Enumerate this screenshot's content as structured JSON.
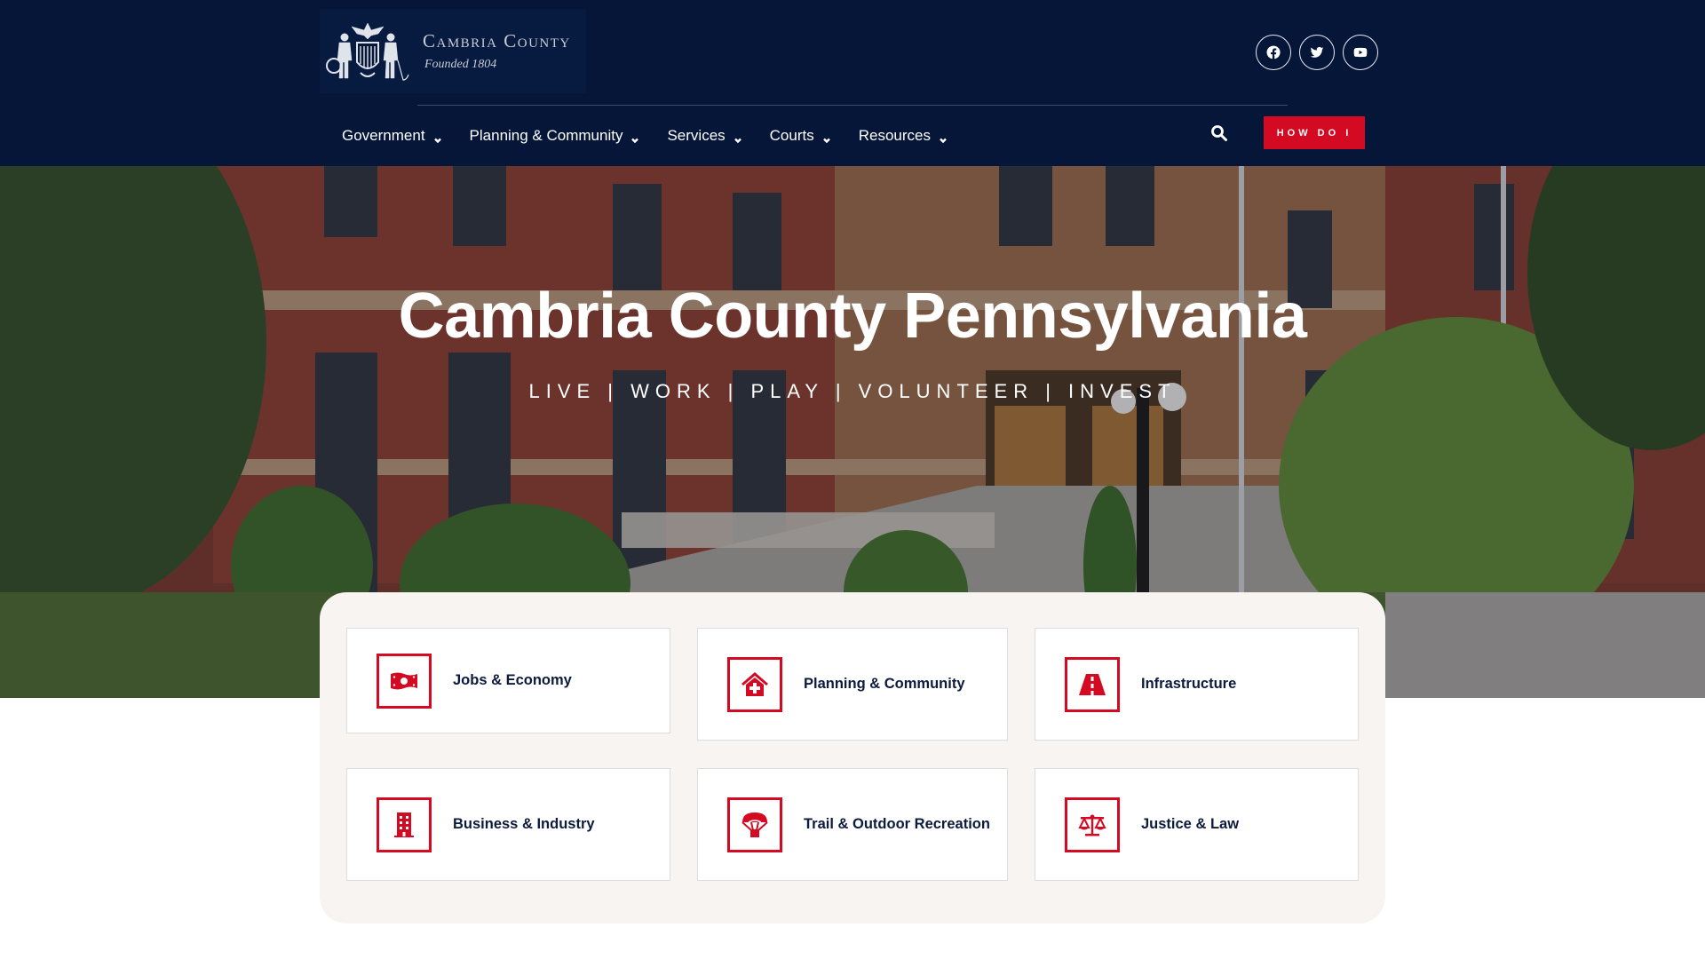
{
  "header": {
    "logo": {
      "name": "Cambria County",
      "tagline": "Founded 1804"
    },
    "social": [
      {
        "name": "facebook",
        "icon": "facebook-icon"
      },
      {
        "name": "twitter",
        "icon": "twitter-icon"
      },
      {
        "name": "youtube",
        "icon": "youtube-icon"
      }
    ],
    "nav": [
      {
        "label": "Government",
        "has_dropdown": true
      },
      {
        "label": "Planning & Community",
        "has_dropdown": true
      },
      {
        "label": "Services",
        "has_dropdown": true
      },
      {
        "label": "Courts",
        "has_dropdown": true
      },
      {
        "label": "Resources",
        "has_dropdown": true
      }
    ],
    "search_icon": "search-icon",
    "cta_label": "HOW DO I"
  },
  "hero": {
    "title": "Cambria County Pennsylvania",
    "subtitle": "LIVE | WORK | PLAY | VOLUNTEER | INVEST"
  },
  "categories": [
    {
      "label": "Jobs & Economy",
      "icon": "money-bill-icon"
    },
    {
      "label": "Planning & Community",
      "icon": "house-medical-icon"
    },
    {
      "label": "Infrastructure",
      "icon": "road-icon"
    },
    {
      "label": "Business & Industry",
      "icon": "building-icon"
    },
    {
      "label": "Trail & Outdoor Recreation",
      "icon": "parachute-box-icon"
    },
    {
      "label": "Justice & Law",
      "icon": "balance-scale-icon"
    }
  ],
  "colors": {
    "header_bg": "#061639",
    "accent_red": "#d30a22",
    "panel_bg": "#f7f4f2",
    "card_text": "#0c1a3d"
  }
}
